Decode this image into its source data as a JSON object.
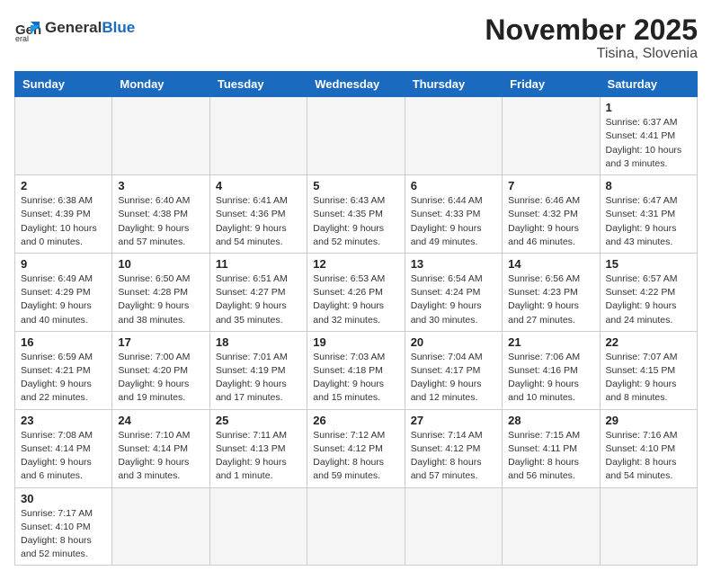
{
  "logo": {
    "general": "General",
    "blue": "Blue"
  },
  "header": {
    "month": "November 2025",
    "location": "Tisina, Slovenia"
  },
  "weekdays": [
    "Sunday",
    "Monday",
    "Tuesday",
    "Wednesday",
    "Thursday",
    "Friday",
    "Saturday"
  ],
  "weeks": [
    [
      {
        "day": "",
        "info": ""
      },
      {
        "day": "",
        "info": ""
      },
      {
        "day": "",
        "info": ""
      },
      {
        "day": "",
        "info": ""
      },
      {
        "day": "",
        "info": ""
      },
      {
        "day": "",
        "info": ""
      },
      {
        "day": "1",
        "info": "Sunrise: 6:37 AM\nSunset: 4:41 PM\nDaylight: 10 hours\nand 3 minutes."
      }
    ],
    [
      {
        "day": "2",
        "info": "Sunrise: 6:38 AM\nSunset: 4:39 PM\nDaylight: 10 hours\nand 0 minutes."
      },
      {
        "day": "3",
        "info": "Sunrise: 6:40 AM\nSunset: 4:38 PM\nDaylight: 9 hours\nand 57 minutes."
      },
      {
        "day": "4",
        "info": "Sunrise: 6:41 AM\nSunset: 4:36 PM\nDaylight: 9 hours\nand 54 minutes."
      },
      {
        "day": "5",
        "info": "Sunrise: 6:43 AM\nSunset: 4:35 PM\nDaylight: 9 hours\nand 52 minutes."
      },
      {
        "day": "6",
        "info": "Sunrise: 6:44 AM\nSunset: 4:33 PM\nDaylight: 9 hours\nand 49 minutes."
      },
      {
        "day": "7",
        "info": "Sunrise: 6:46 AM\nSunset: 4:32 PM\nDaylight: 9 hours\nand 46 minutes."
      },
      {
        "day": "8",
        "info": "Sunrise: 6:47 AM\nSunset: 4:31 PM\nDaylight: 9 hours\nand 43 minutes."
      }
    ],
    [
      {
        "day": "9",
        "info": "Sunrise: 6:49 AM\nSunset: 4:29 PM\nDaylight: 9 hours\nand 40 minutes."
      },
      {
        "day": "10",
        "info": "Sunrise: 6:50 AM\nSunset: 4:28 PM\nDaylight: 9 hours\nand 38 minutes."
      },
      {
        "day": "11",
        "info": "Sunrise: 6:51 AM\nSunset: 4:27 PM\nDaylight: 9 hours\nand 35 minutes."
      },
      {
        "day": "12",
        "info": "Sunrise: 6:53 AM\nSunset: 4:26 PM\nDaylight: 9 hours\nand 32 minutes."
      },
      {
        "day": "13",
        "info": "Sunrise: 6:54 AM\nSunset: 4:24 PM\nDaylight: 9 hours\nand 30 minutes."
      },
      {
        "day": "14",
        "info": "Sunrise: 6:56 AM\nSunset: 4:23 PM\nDaylight: 9 hours\nand 27 minutes."
      },
      {
        "day": "15",
        "info": "Sunrise: 6:57 AM\nSunset: 4:22 PM\nDaylight: 9 hours\nand 24 minutes."
      }
    ],
    [
      {
        "day": "16",
        "info": "Sunrise: 6:59 AM\nSunset: 4:21 PM\nDaylight: 9 hours\nand 22 minutes."
      },
      {
        "day": "17",
        "info": "Sunrise: 7:00 AM\nSunset: 4:20 PM\nDaylight: 9 hours\nand 19 minutes."
      },
      {
        "day": "18",
        "info": "Sunrise: 7:01 AM\nSunset: 4:19 PM\nDaylight: 9 hours\nand 17 minutes."
      },
      {
        "day": "19",
        "info": "Sunrise: 7:03 AM\nSunset: 4:18 PM\nDaylight: 9 hours\nand 15 minutes."
      },
      {
        "day": "20",
        "info": "Sunrise: 7:04 AM\nSunset: 4:17 PM\nDaylight: 9 hours\nand 12 minutes."
      },
      {
        "day": "21",
        "info": "Sunrise: 7:06 AM\nSunset: 4:16 PM\nDaylight: 9 hours\nand 10 minutes."
      },
      {
        "day": "22",
        "info": "Sunrise: 7:07 AM\nSunset: 4:15 PM\nDaylight: 9 hours\nand 8 minutes."
      }
    ],
    [
      {
        "day": "23",
        "info": "Sunrise: 7:08 AM\nSunset: 4:14 PM\nDaylight: 9 hours\nand 6 minutes."
      },
      {
        "day": "24",
        "info": "Sunrise: 7:10 AM\nSunset: 4:14 PM\nDaylight: 9 hours\nand 3 minutes."
      },
      {
        "day": "25",
        "info": "Sunrise: 7:11 AM\nSunset: 4:13 PM\nDaylight: 9 hours\nand 1 minute."
      },
      {
        "day": "26",
        "info": "Sunrise: 7:12 AM\nSunset: 4:12 PM\nDaylight: 8 hours\nand 59 minutes."
      },
      {
        "day": "27",
        "info": "Sunrise: 7:14 AM\nSunset: 4:12 PM\nDaylight: 8 hours\nand 57 minutes."
      },
      {
        "day": "28",
        "info": "Sunrise: 7:15 AM\nSunset: 4:11 PM\nDaylight: 8 hours\nand 56 minutes."
      },
      {
        "day": "29",
        "info": "Sunrise: 7:16 AM\nSunset: 4:10 PM\nDaylight: 8 hours\nand 54 minutes."
      }
    ],
    [
      {
        "day": "30",
        "info": "Sunrise: 7:17 AM\nSunset: 4:10 PM\nDaylight: 8 hours\nand 52 minutes."
      },
      {
        "day": "",
        "info": ""
      },
      {
        "day": "",
        "info": ""
      },
      {
        "day": "",
        "info": ""
      },
      {
        "day": "",
        "info": ""
      },
      {
        "day": "",
        "info": ""
      },
      {
        "day": "",
        "info": ""
      }
    ]
  ]
}
